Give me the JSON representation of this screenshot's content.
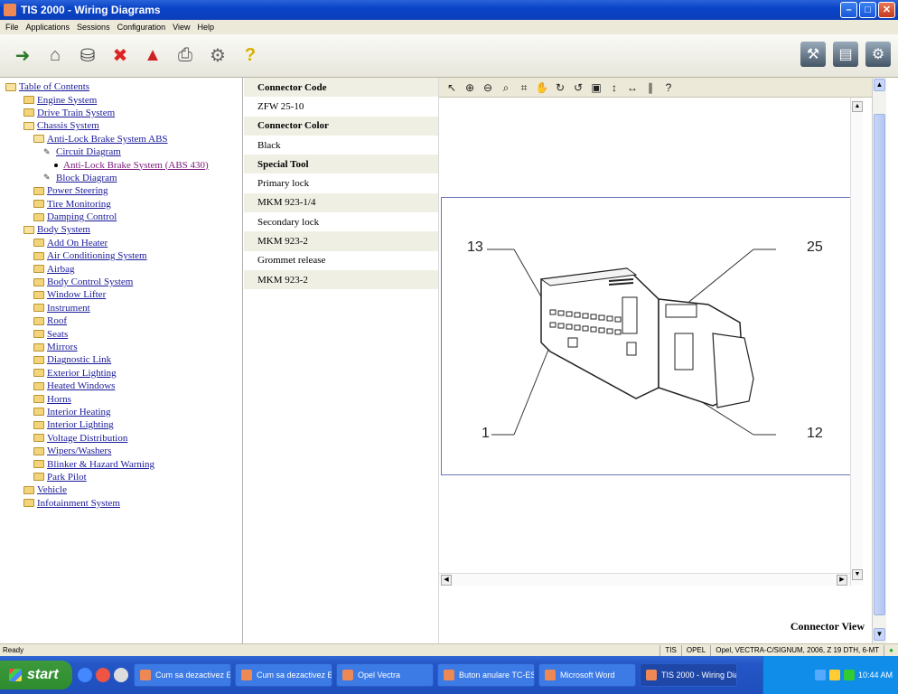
{
  "window": {
    "title": "TIS 2000 - Wiring Diagrams"
  },
  "menu": [
    "File",
    "Applications",
    "Sessions",
    "Configuration",
    "View",
    "Help"
  ],
  "toolbar_icons": [
    "exit-icon",
    "home-icon",
    "car-icon",
    "stop-icon",
    "person-icon",
    "printer-icon",
    "tools-icon",
    "help-icon"
  ],
  "toolbar_right_icons": [
    "diagnostics-icon",
    "document-icon",
    "vehicle-tool-icon"
  ],
  "tree": [
    {
      "label": "Table of Contents",
      "level": 0,
      "icon": "folder-open"
    },
    {
      "label": "Engine System",
      "level": 1,
      "icon": "folder"
    },
    {
      "label": "Drive Train System",
      "level": 1,
      "icon": "folder"
    },
    {
      "label": "Chassis System",
      "level": 1,
      "icon": "folder-open"
    },
    {
      "label": "Anti-Lock Brake System ABS",
      "level": 2,
      "icon": "folder-open"
    },
    {
      "label": "Circuit Diagram",
      "level": 3,
      "icon": "diagram"
    },
    {
      "label": "Anti-Lock Brake System (ABS 430)",
      "level": 4,
      "icon": "bullet",
      "active": true
    },
    {
      "label": "Block Diagram",
      "level": 3,
      "icon": "diagram"
    },
    {
      "label": "Power Steering",
      "level": 2,
      "icon": "folder"
    },
    {
      "label": "Tire Monitoring",
      "level": 2,
      "icon": "folder"
    },
    {
      "label": "Damping Control",
      "level": 2,
      "icon": "folder"
    },
    {
      "label": "Body System",
      "level": 1,
      "icon": "folder-open"
    },
    {
      "label": "Add On Heater",
      "level": 2,
      "icon": "folder"
    },
    {
      "label": "Air Conditioning System",
      "level": 2,
      "icon": "folder"
    },
    {
      "label": "Airbag",
      "level": 2,
      "icon": "folder"
    },
    {
      "label": "Body Control System",
      "level": 2,
      "icon": "folder"
    },
    {
      "label": "Window Lifter",
      "level": 2,
      "icon": "folder"
    },
    {
      "label": "Instrument",
      "level": 2,
      "icon": "folder"
    },
    {
      "label": "Roof",
      "level": 2,
      "icon": "folder"
    },
    {
      "label": "Seats",
      "level": 2,
      "icon": "folder"
    },
    {
      "label": "Mirrors",
      "level": 2,
      "icon": "folder"
    },
    {
      "label": "Diagnostic Link",
      "level": 2,
      "icon": "folder"
    },
    {
      "label": "Exterior Lighting",
      "level": 2,
      "icon": "folder"
    },
    {
      "label": "Heated Windows",
      "level": 2,
      "icon": "folder"
    },
    {
      "label": "Horns",
      "level": 2,
      "icon": "folder"
    },
    {
      "label": "Interior Heating",
      "level": 2,
      "icon": "folder"
    },
    {
      "label": "Interior Lighting",
      "level": 2,
      "icon": "folder"
    },
    {
      "label": "Voltage Distribution",
      "level": 2,
      "icon": "folder"
    },
    {
      "label": "Wipers/Washers",
      "level": 2,
      "icon": "folder"
    },
    {
      "label": "Blinker & Hazard Warning",
      "level": 2,
      "icon": "folder"
    },
    {
      "label": "Park Pilot",
      "level": 2,
      "icon": "folder"
    },
    {
      "label": "Vehicle",
      "level": 1,
      "icon": "folder"
    },
    {
      "label": "Infotainment System",
      "level": 1,
      "icon": "folder"
    }
  ],
  "info_rows": [
    {
      "text": "Connector Code",
      "head": true
    },
    {
      "text": "ZFW 25-10",
      "head": false
    },
    {
      "text": "Connector Color",
      "head": true
    },
    {
      "text": "Black",
      "head": false
    },
    {
      "text": "Special Tool",
      "head": true
    },
    {
      "text": "Primary lock",
      "head": false
    },
    {
      "text": "MKM 923-1/4",
      "head": false
    },
    {
      "text": "Secondary lock",
      "head": false
    },
    {
      "text": "MKM 923-2",
      "head": false
    },
    {
      "text": "Grommet release",
      "head": false
    },
    {
      "text": "MKM 923-2",
      "head": false
    }
  ],
  "viewer": {
    "tools": [
      "select-arrow-icon",
      "zoom-in-icon",
      "zoom-out-icon",
      "zoom-area-icon",
      "zoom-window-icon",
      "pan-hand-icon",
      "rotate-cw-icon",
      "rotate-ccw-icon",
      "fit-page-icon",
      "fit-height-icon",
      "fit-width-icon",
      "measure-icon",
      "help-icon"
    ],
    "pin_labels": {
      "top_left": "13",
      "top_right": "25",
      "bottom_left": "1",
      "bottom_right": "12"
    },
    "caption": "Connector View"
  },
  "status": {
    "ready": "Ready",
    "cells": [
      "TIS",
      "OPEL",
      "Opel, VECTRA-C/SIGNUM, 2006, Z 19 DTH, 6-MT"
    ]
  },
  "taskbar": {
    "start": "start",
    "tasks": [
      {
        "label": "Cum sa dezactivez ES...",
        "active": false
      },
      {
        "label": "Cum sa dezactivez ES...",
        "active": false
      },
      {
        "label": "Opel Vectra",
        "active": false
      },
      {
        "label": "Buton anulare TC-ES...",
        "active": false
      },
      {
        "label": "Microsoft Word",
        "active": false
      },
      {
        "label": "TIS 2000 - Wiring Dia...",
        "active": true
      }
    ],
    "clock": "10:44 AM"
  }
}
